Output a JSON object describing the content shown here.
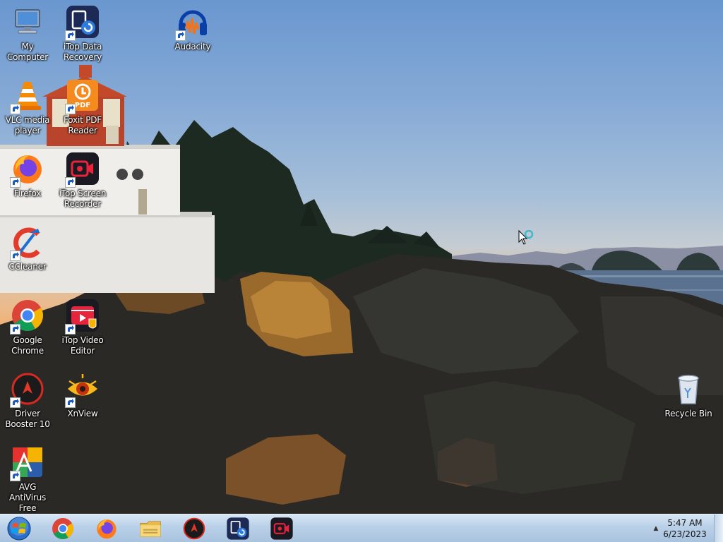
{
  "desktop": {
    "icons": [
      {
        "label": "My Computer",
        "icon": "computer-icon"
      },
      {
        "label": "iTop Data Recovery",
        "icon": "itop-data-recovery-icon"
      },
      {
        "label": "Audacity",
        "icon": "audacity-icon"
      },
      {
        "label": "VLC media player",
        "icon": "vlc-icon"
      },
      {
        "label": "Foxit PDF Reader",
        "icon": "foxit-pdf-icon"
      },
      {
        "label": "Firefox",
        "icon": "firefox-icon"
      },
      {
        "label": "iTop Screen Recorder",
        "icon": "itop-screen-recorder-icon"
      },
      {
        "label": "CCleaner",
        "icon": "ccleaner-icon"
      },
      {
        "label": "Google Chrome",
        "icon": "chrome-icon"
      },
      {
        "label": "iTop Video Editor",
        "icon": "itop-video-editor-icon"
      },
      {
        "label": "Driver Booster 10",
        "icon": "driver-booster-icon"
      },
      {
        "label": "XnView",
        "icon": "xnview-icon"
      },
      {
        "label": "AVG AntiVirus Free",
        "icon": "avg-icon"
      },
      {
        "label": "Recycle Bin",
        "icon": "recycle-bin-icon"
      }
    ]
  },
  "taskbar": {
    "start": "windows-orb-icon",
    "pinned": [
      "chrome-icon",
      "firefox-icon",
      "file-explorer-icon",
      "driver-booster-icon",
      "itop-data-recovery-icon",
      "itop-screen-recorder-icon"
    ],
    "tray_chevron": "▲",
    "clock": {
      "time": "5:47 AM",
      "date": "6/23/2023"
    }
  },
  "colors": {
    "taskbar": "#b9d0e8",
    "itop_bg": "#1d2a55",
    "itop_red": "#e8243c",
    "chrome_red": "#db4437",
    "chrome_yellow": "#f4b400",
    "chrome_green": "#0f9d58",
    "chrome_blue": "#4285f4"
  }
}
